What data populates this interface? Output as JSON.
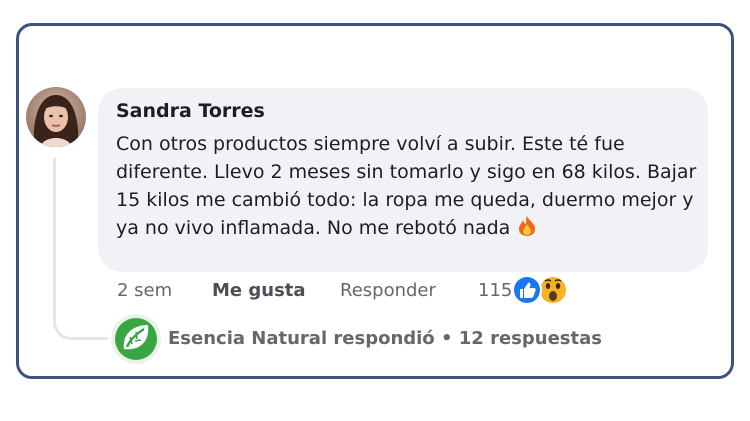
{
  "comment": {
    "author": "Sandra Torres",
    "text": "Con otros productos siempre volví a subir. Este té fue diferente. Llevo 2 meses sin tomarlo y sigo en 68 kilos. Bajar 15 kilos me cambió todo: la ropa me queda, duermo mejor y ya no vivo inflamada. No me rebotó nada",
    "emoji_icon": "fire-emoji-icon"
  },
  "actions": {
    "time": "2 sem",
    "like": "Me gusta",
    "reply": "Responder",
    "reaction_count": "115",
    "reaction_icons": [
      "like-reaction-icon",
      "wow-reaction-icon"
    ]
  },
  "reply_summary": {
    "page_name": "Esencia Natural",
    "replied": "respondió",
    "separator": "•",
    "replies": "12 respuestas"
  },
  "colors": {
    "frame_border": "#3b5282",
    "bubble_bg": "#f0f2f5",
    "like_blue": "#1877f2",
    "brand_green": "#3aa543"
  }
}
